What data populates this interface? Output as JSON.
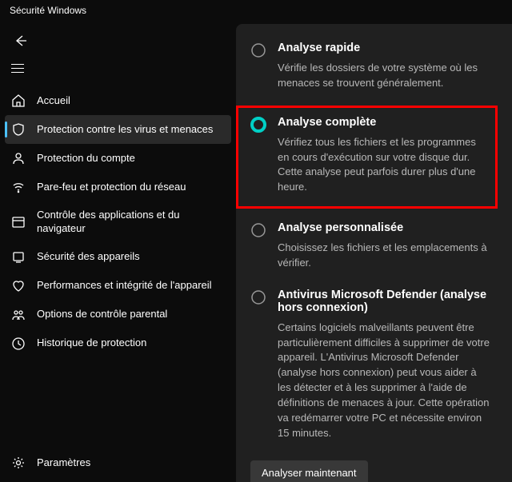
{
  "window": {
    "title": "Sécurité Windows"
  },
  "sidebar": {
    "items": [
      {
        "label": "Accueil"
      },
      {
        "label": "Protection contre les virus et menaces"
      },
      {
        "label": "Protection du compte"
      },
      {
        "label": "Pare-feu et protection du réseau"
      },
      {
        "label": "Contrôle des applications et du navigateur"
      },
      {
        "label": "Sécurité des appareils"
      },
      {
        "label": "Performances et intégrité de l'appareil"
      },
      {
        "label": "Options de contrôle parental"
      },
      {
        "label": "Historique de protection"
      }
    ],
    "footer": {
      "label": "Paramètres"
    }
  },
  "options": [
    {
      "title": "Analyse rapide",
      "desc": "Vérifie les dossiers de votre système où les menaces se trouvent généralement.",
      "selected": false
    },
    {
      "title": "Analyse complète",
      "desc": "Vérifiez tous les fichiers et les programmes en cours d'exécution sur votre disque dur. Cette analyse peut parfois durer plus d'une heure.",
      "selected": true
    },
    {
      "title": "Analyse personnalisée",
      "desc": "Choisissez les fichiers et les emplacements à vérifier.",
      "selected": false
    },
    {
      "title": "Antivirus Microsoft Defender (analyse hors connexion)",
      "desc": "Certains logiciels malveillants peuvent être particulièrement difficiles à supprimer de votre appareil. L'Antivirus Microsoft Defender (analyse hors connexion) peut vous aider à les détecter et à les supprimer à l'aide de définitions de menaces à jour. Cette opération va redémarrer votre PC et nécessite environ 15 minutes.",
      "selected": false
    }
  ],
  "action": {
    "scan_label": "Analyser maintenant"
  },
  "colors": {
    "accent": "#00d0c6",
    "highlight_border": "#ff0000"
  }
}
